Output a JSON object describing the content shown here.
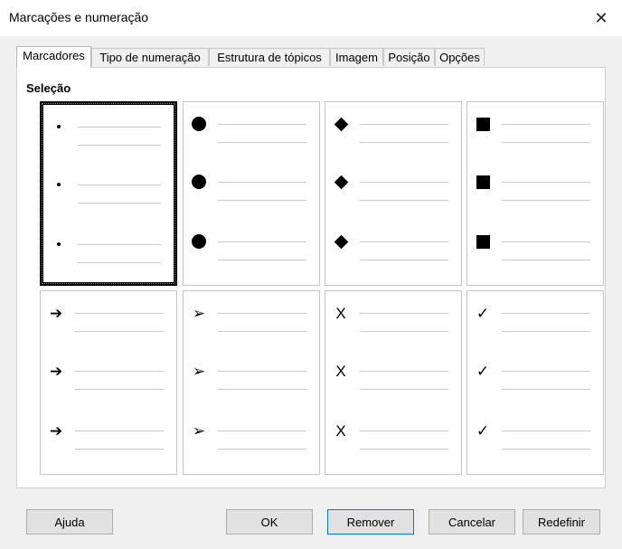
{
  "window": {
    "title": "Marcações e numeração",
    "close_symbol": "✕"
  },
  "tabs": [
    "Marcadores",
    "Tipo de numeração",
    "Estrutura de tópicos",
    "Imagem",
    "Posição",
    "Opções"
  ],
  "selected_tab": "Marcadores",
  "section_label": "Seleção",
  "bullet_styles": [
    {
      "icon": "small-dot",
      "glyph": ""
    },
    {
      "icon": "filled-circle",
      "glyph": ""
    },
    {
      "icon": "diamond",
      "glyph": ""
    },
    {
      "icon": "filled-square",
      "glyph": ""
    },
    {
      "icon": "arrow",
      "glyph": "➔"
    },
    {
      "icon": "arrowhead",
      "glyph": "➢"
    },
    {
      "icon": "x-mark",
      "glyph": "X"
    },
    {
      "icon": "check-mark",
      "glyph": "✓"
    }
  ],
  "selected_style_index": 0,
  "buttons": {
    "help": "Ajuda",
    "ok": "OK",
    "remove": "Remover",
    "cancel": "Cancelar",
    "reset": "Redefinir"
  }
}
